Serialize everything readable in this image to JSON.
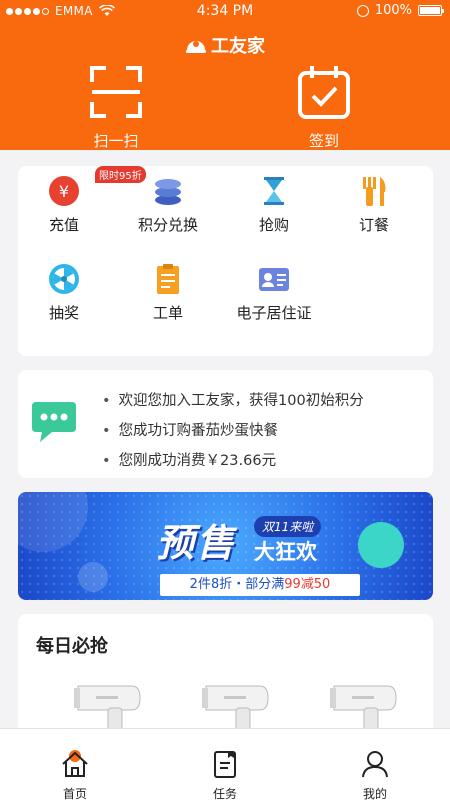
{
  "status_bar": {
    "carrier": "EMMA",
    "time": "4:34 PM",
    "battery": "100%"
  },
  "header": {
    "title": "工友家",
    "scan_label": "扫一扫",
    "signin_label": "签到"
  },
  "features": [
    {
      "label": "充值",
      "icon": "yuan-icon",
      "badge": "限时95折",
      "color": "#e8412f"
    },
    {
      "label": "积分兑换",
      "icon": "coins-stack-icon",
      "color": "#5a7bd6"
    },
    {
      "label": "抢购",
      "icon": "hourglass-icon",
      "color": "#2fa3d8"
    },
    {
      "label": "订餐",
      "icon": "fork-knife-icon",
      "color": "#f59b1d"
    },
    {
      "label": "抽奖",
      "icon": "wheel-icon",
      "color": "#2fb6e8"
    },
    {
      "label": "工单",
      "icon": "clipboard-icon",
      "color": "#f5a021"
    },
    {
      "label": "电子居住证",
      "icon": "id-card-icon",
      "color": "#6a84e0"
    }
  ],
  "messages": [
    "欢迎您加入工友家，获得100初始积分",
    "您成功订购番茄炒蛋快餐",
    "您刚成功消费￥23.66元"
  ],
  "banner": {
    "headline": "预售",
    "tag": "双11来啦",
    "subtitle": "大狂欢",
    "strip_left": "2件8折・部分满",
    "strip_highlight": "99减50",
    "accent": "#2a6fe8"
  },
  "daily": {
    "title": "每日必抢"
  },
  "tabs": [
    {
      "label": "首页",
      "icon": "home-icon"
    },
    {
      "label": "任务",
      "icon": "task-icon"
    },
    {
      "label": "我的",
      "icon": "user-icon"
    }
  ],
  "colors": {
    "brand": "#f96a0e",
    "background": "#f3f3f6"
  }
}
